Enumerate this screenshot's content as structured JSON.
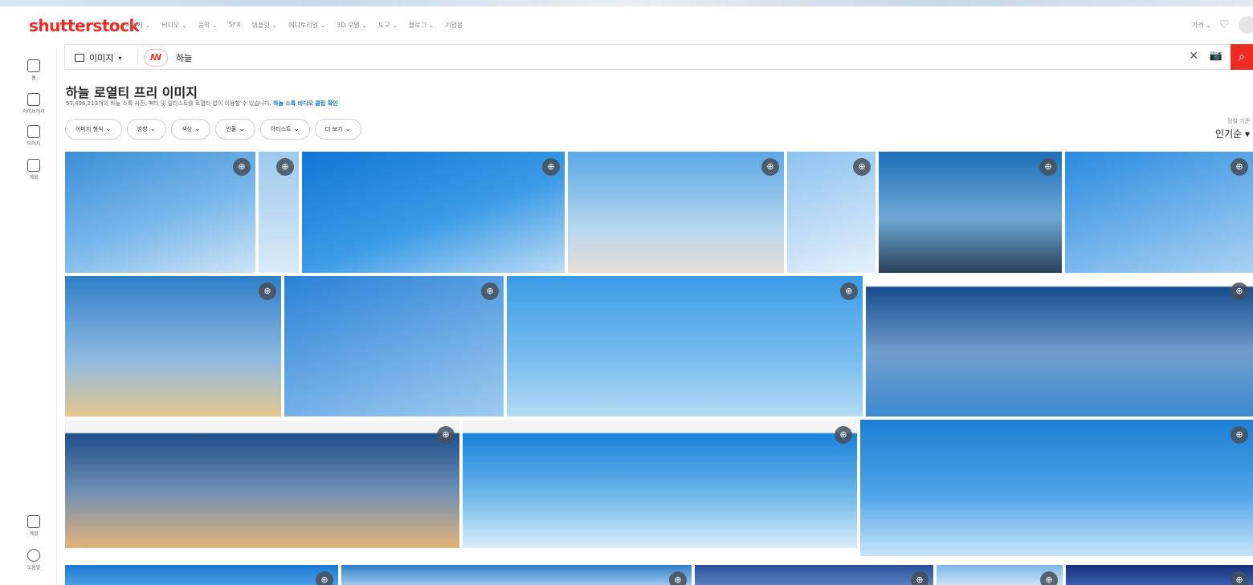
{
  "header": {
    "logo": "shutterstock",
    "nav": [
      "이미지 ⌄",
      "비디오 ⌄",
      "음악 ⌄",
      "SFX",
      "템플릿 ⌄",
      "에디토리얼 ⌄",
      "3D 모델 ⌄",
      "도구 ⌄",
      "블로그 ⌄",
      "기업용"
    ],
    "price_label": "가격 ⌄"
  },
  "sidebar": [
    {
      "label": "홈",
      "icon": "home-icon"
    },
    {
      "label": "라이브러리",
      "icon": "library-icon"
    },
    {
      "label": "이미지",
      "icon": "images-icon"
    },
    {
      "label": "계획",
      "icon": "plans-icon"
    },
    {
      "label": "계정",
      "icon": "account-icon"
    },
    {
      "label": "도움말",
      "icon": "help-icon"
    }
  ],
  "search": {
    "type_label": "이미지",
    "query": "하늘"
  },
  "page": {
    "title": "하늘 로열티 프리 이미지",
    "subtitle": "53,496,213개의 하늘 스톡 사진, 벡터 및 일러스트를 로열티 없이 이용할 수 있습니다.",
    "subtitle_link": "하늘 스톡 비디오 클립 확인"
  },
  "filters": [
    "이미지 형식",
    "방향",
    "색상",
    "인물",
    "아티스트",
    "더 보기"
  ],
  "sort": {
    "label": "정렬 기준",
    "value": "인기순"
  },
  "colors": {
    "brand": "#ee2b24",
    "link": "#1a6fd0"
  }
}
